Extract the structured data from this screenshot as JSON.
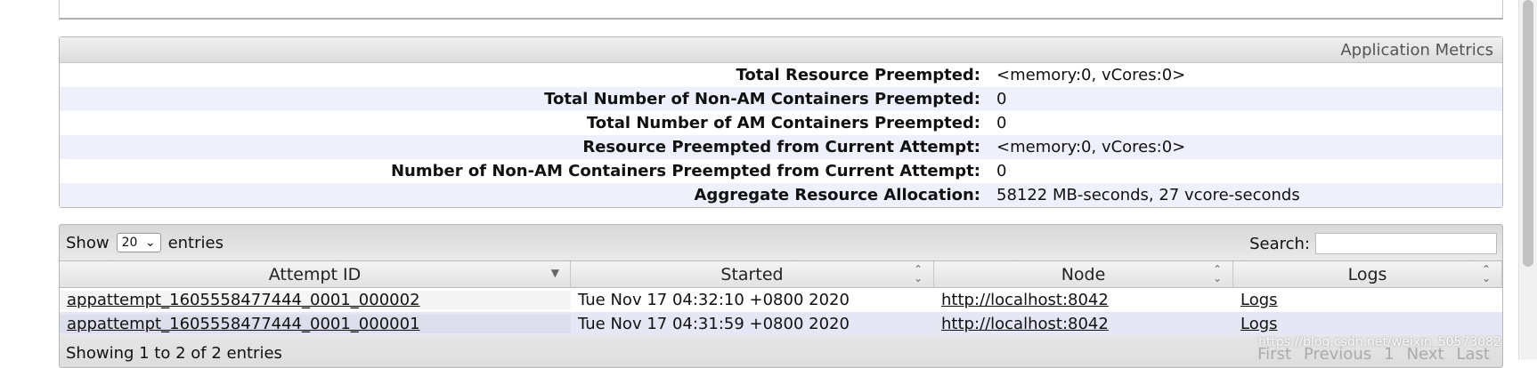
{
  "metrics": {
    "title": "Application Metrics",
    "rows": [
      {
        "label": "Total Resource Preempted:",
        "value": "<memory:0, vCores:0>"
      },
      {
        "label": "Total Number of Non-AM Containers Preempted:",
        "value": "0"
      },
      {
        "label": "Total Number of AM Containers Preempted:",
        "value": "0"
      },
      {
        "label": "Resource Preempted from Current Attempt:",
        "value": "<memory:0, vCores:0>"
      },
      {
        "label": "Number of Non-AM Containers Preempted from Current Attempt:",
        "value": "0"
      },
      {
        "label": "Aggregate Resource Allocation:",
        "value": "58122 MB-seconds, 27 vcore-seconds"
      }
    ]
  },
  "table": {
    "show_label": "Show",
    "entries_label": "entries",
    "page_size": "20",
    "search_label": "Search:",
    "search_value": "",
    "columns": [
      "Attempt ID",
      "Started",
      "Node",
      "Logs"
    ],
    "rows": [
      {
        "attempt_id": "appattempt_1605558477444_0001_000002",
        "started": "Tue Nov 17 04:32:10 +0800 2020",
        "node": "http://localhost:8042",
        "logs": "Logs"
      },
      {
        "attempt_id": "appattempt_1605558477444_0001_000001",
        "started": "Tue Nov 17 04:31:59 +0800 2020",
        "node": "http://localhost:8042",
        "logs": "Logs"
      }
    ],
    "info": "Showing 1 to 2 of 2 entries",
    "pager": {
      "first": "First",
      "previous": "Previous",
      "page": "1",
      "next": "Next",
      "last": "Last"
    }
  },
  "watermark": "https://blog.csdn.net/weixin_50573082"
}
